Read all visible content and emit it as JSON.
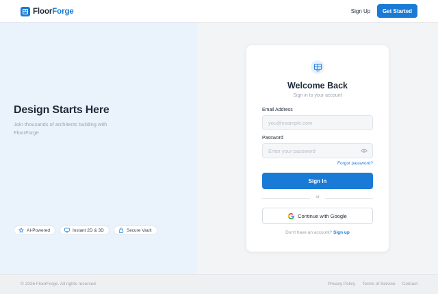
{
  "header": {
    "logo_prefix": "Floor",
    "logo_accent": "Forge",
    "signup_label": "Sign Up",
    "get_started_label": "Get Started"
  },
  "hero": {
    "title": "Design Starts Here",
    "subtitle": "Join thousands of architects building with FloorForge",
    "features": [
      {
        "icon": "star-icon",
        "label": "AI-Powered"
      },
      {
        "icon": "monitor-icon",
        "label": "Instant 2D & 3D"
      },
      {
        "icon": "lock-icon",
        "label": "Secure Vault"
      }
    ]
  },
  "login": {
    "icon": "floorplan-icon",
    "title": "Welcome Back",
    "subtitle": "Sign in to your account",
    "email_label": "Email Address",
    "email_placeholder": "you@example.com",
    "email_value": "",
    "password_label": "Password",
    "password_placeholder": "Enter your password",
    "password_value": "",
    "forgot_label": "Forgot password?",
    "signin_label": "Sign In",
    "divider_text": "or",
    "google_label": "Continue with Google",
    "no_account_text": "Don't have an account?",
    "signup_link": "Sign up"
  },
  "footer": {
    "copyright": "© 2026 FloorForge. All rights reserved.",
    "links": [
      "Privacy Policy",
      "Terms of Service",
      "Contact"
    ]
  },
  "colors": {
    "accent": "#1a7bd6",
    "hero_bg": "#eaf3fc",
    "right_bg": "#f3f4f6"
  }
}
